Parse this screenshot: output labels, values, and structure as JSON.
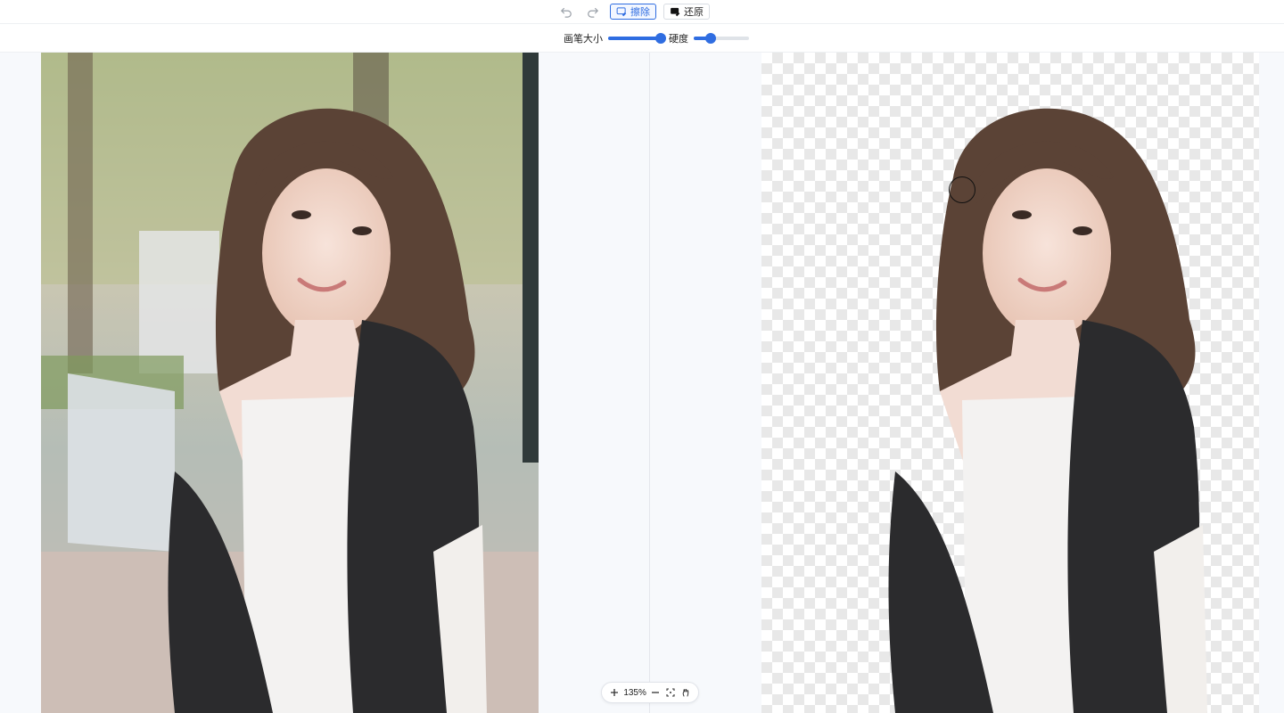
{
  "toolbar": {
    "undo_icon": "undo-icon",
    "redo_icon": "redo-icon",
    "erase_label": "擦除",
    "restore_label": "还原",
    "active_mode": "erase",
    "accent_color": "#2f6de1"
  },
  "brush_settings": {
    "size_label": "画笔大小",
    "size_level": 0.95,
    "hardness_label": "硬度",
    "hardness_level": 0.3
  },
  "zoom": {
    "zoom_in_icon": "plus-icon",
    "level_text": "135%",
    "zoom_out_icon": "minus-icon",
    "fit_icon": "fit-screen-icon",
    "pan_icon": "hand-icon"
  }
}
